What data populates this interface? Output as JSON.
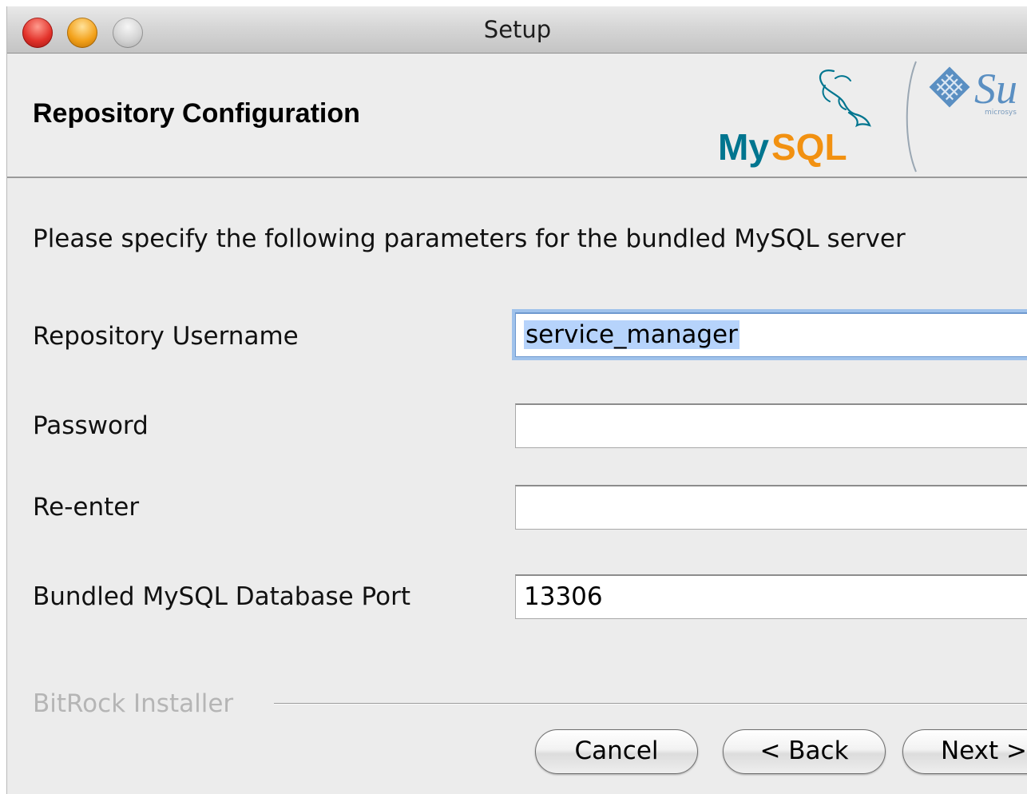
{
  "window": {
    "title": "Setup"
  },
  "header": {
    "title": "Repository Configuration",
    "logos": {
      "mysql_text": "MySQL",
      "sun_text": "Su",
      "sun_subtext": "microsys",
      "mysql_color": "#00758f",
      "mysql_accent": "#f29111",
      "sun_color": "#5a8fc2"
    }
  },
  "form": {
    "intro": "Please specify the following parameters for the bundled MySQL server",
    "fields": {
      "username": {
        "label": "Repository Username",
        "value": "service_manager"
      },
      "password": {
        "label": "Password",
        "value": ""
      },
      "reenter": {
        "label": "Re-enter",
        "value": ""
      },
      "port": {
        "label": "Bundled MySQL Database Port",
        "value": "13306"
      }
    }
  },
  "footer": {
    "installer_label": "BitRock Installer",
    "buttons": {
      "cancel": "Cancel",
      "back": "< Back",
      "next": "Next >"
    }
  }
}
